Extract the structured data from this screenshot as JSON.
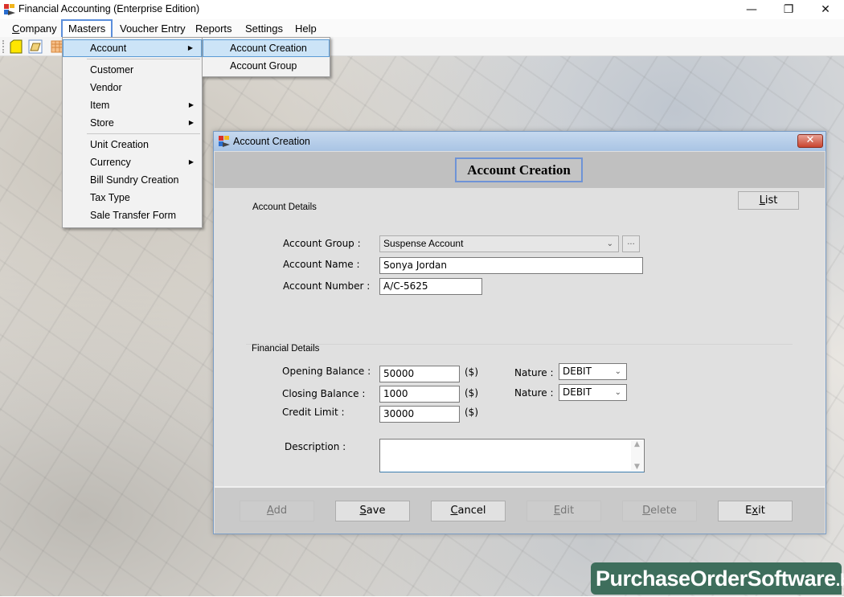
{
  "window": {
    "title": "Financial Accounting (Enterprise Edition)",
    "controls": {
      "minimize": "—",
      "restore": "❐",
      "close": "✕"
    }
  },
  "menubar": {
    "items": [
      {
        "label": "Company",
        "accel": "C"
      },
      {
        "label": "Masters",
        "active": true
      },
      {
        "label": "Voucher Entry"
      },
      {
        "label": "Reports"
      },
      {
        "label": "Settings"
      },
      {
        "label": "Help"
      }
    ]
  },
  "toolbar": {
    "buttons": [
      {
        "icon": "new-file-icon"
      },
      {
        "icon": "open-folder-icon"
      },
      {
        "icon": "calendar-grid-icon"
      }
    ]
  },
  "masters_menu": {
    "items": [
      {
        "label": "Account",
        "submenu": true,
        "highlighted": true
      },
      {
        "separator": true
      },
      {
        "label": "Customer"
      },
      {
        "label": "Vendor"
      },
      {
        "label": "Item",
        "submenu": true
      },
      {
        "label": "Store",
        "submenu": true
      },
      {
        "separator": true
      },
      {
        "label": "Unit Creation"
      },
      {
        "label": "Currency",
        "submenu": true
      },
      {
        "label": "Bill Sundry Creation"
      },
      {
        "label": "Tax Type"
      },
      {
        "label": "Sale Transfer Form"
      }
    ],
    "arrow_glyph": "▶"
  },
  "account_submenu": {
    "items": [
      {
        "label": "Account Creation",
        "highlighted": true
      },
      {
        "label": "Account Group"
      }
    ]
  },
  "dialog": {
    "title": "Account Creation",
    "close_glyph": "✕",
    "heading": "Account Creation",
    "list_button": {
      "label": "List",
      "accel": "L"
    },
    "account_details": {
      "section_label": "Account Details",
      "account_group_label": "Account Group :",
      "account_group_value": "Suspense Account",
      "ellipsis_label": "...",
      "account_name_label": "Account Name :",
      "account_name_value": "Sonya Jordan",
      "account_number_label": "Account Number :",
      "account_number_value": "A/C-5625"
    },
    "financial_details": {
      "section_label": "Financial Details",
      "opening_balance_label": "Opening Balance :",
      "opening_balance_value": "50000",
      "closing_balance_label": "Closing Balance :",
      "closing_balance_value": "1000",
      "credit_limit_label": "Credit Limit :",
      "credit_limit_value": "30000",
      "currency_unit": "($)",
      "nature_label": "Nature :",
      "opening_nature": "DEBIT",
      "closing_nature": "DEBIT"
    },
    "description_label": "Description :",
    "description_value": "",
    "chevron_glyph": "⌄",
    "buttons": [
      {
        "id": "add",
        "pre": "",
        "accel": "A",
        "post": "dd",
        "enabled": false
      },
      {
        "id": "save",
        "pre": "",
        "accel": "S",
        "post": "ave",
        "enabled": true
      },
      {
        "id": "cancel",
        "pre": "",
        "accel": "C",
        "post": "ancel",
        "enabled": true
      },
      {
        "id": "edit",
        "pre": "",
        "accel": "E",
        "post": "dit",
        "enabled": false
      },
      {
        "id": "delete",
        "pre": "",
        "accel": "D",
        "post": "elete",
        "enabled": false
      },
      {
        "id": "exit",
        "pre": "E",
        "accel": "x",
        "post": "it",
        "enabled": true
      }
    ]
  },
  "watermark": {
    "name": "PurchaseOrderSoftware",
    "tld": ".biz",
    "color": "#3e6e5c"
  }
}
